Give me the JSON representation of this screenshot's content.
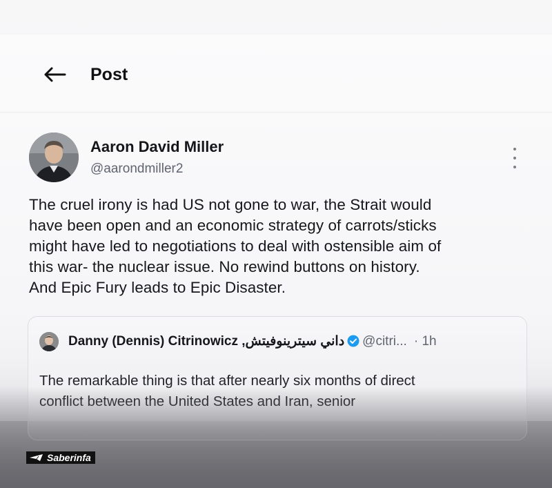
{
  "header": {
    "title": "Post",
    "back_icon": "arrow-left-icon"
  },
  "post": {
    "author_name": "Aaron David Miller",
    "author_handle": "@aarondmiller2",
    "more_icon": "more-vertical-icon",
    "text_lines": [
      "The cruel irony is had US  not gone to war, the Strait would",
      "have been open and an economic strategy of carrots/sticks",
      "might have led to negotiations to deal with ostensible aim of",
      "this war- the nuclear issue. No rewind buttons on history.",
      "And Epic Fury leads to Epic Disaster."
    ]
  },
  "quoted_post": {
    "author_name": "Danny (Dennis) Citrinowicz ,داني سيترينوفيتش",
    "verified_icon": "verified-badge-icon",
    "handle": "@citri...",
    "time": "· 1h",
    "text_lines": [
      "The remarkable thing is that after nearly six months of direct",
      "conflict between the United States and Iran, senior"
    ]
  },
  "watermark": {
    "text": "Saberinfa",
    "icon": "telegram-icon"
  },
  "colors": {
    "verified": "#1d9bf0",
    "text": "#16171b",
    "muted": "#5f6470"
  }
}
